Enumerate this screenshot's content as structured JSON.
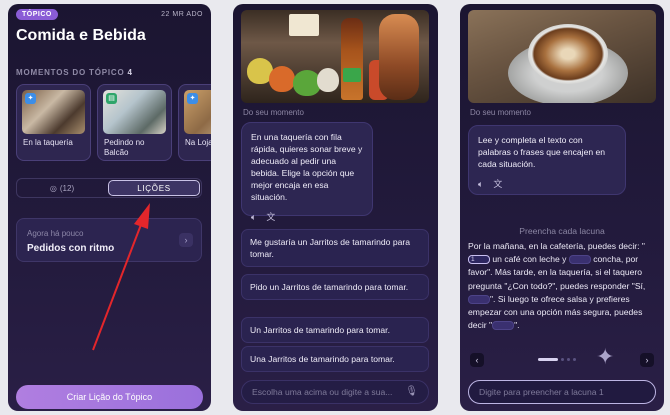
{
  "panel1": {
    "badge": "TÓPICO",
    "date": "22 MR ADO",
    "title": "Comida e Bebida",
    "moments_label": "MOMENTOS DO TÓPICO",
    "moments_count": "4",
    "moments": [
      {
        "label": "En la taquería"
      },
      {
        "label": "Pedindo no Balcão"
      },
      {
        "label": "Na Loja"
      }
    ],
    "tabs": {
      "first": "(12)",
      "second": "LIÇÕES"
    },
    "lesson": {
      "when": "Agora há pouco",
      "name": "Pedidos con ritmo"
    },
    "create_button": "Criar Lição do Tópico"
  },
  "panel2": {
    "from_moment": "Do seu momento",
    "prompt": "En una taquería con fila rápida, quieres sonar breve y adecuado al pedir una bebida. Elige la opción que mejor encaja en esa situación.",
    "options": [
      "Me gustaría un Jarritos de tamarindo para tomar.",
      "Pido un Jarritos de tamarindo para tomar.",
      "Un Jarritos de tamarindo para tomar.",
      "Una Jarritos de tamarindo para tomar."
    ],
    "input_placeholder": "Escolha uma acima ou digite a sua..."
  },
  "panel3": {
    "from_moment": "Do seu momento",
    "prompt": "Lee y completa el texto con palabras o frases que encajen en cada situación.",
    "hint": "Preencha cada lacuna",
    "cloze": {
      "p1": "Por la mañana, en la cafetería, puedes decir: \"",
      "blank1": "1",
      "p2": " un café con leche y ",
      "p3": " concha, por favor\". Más tarde, en la taquería, si el taquero pregunta \"¿Con todo?\", puedes responder \"Sí, ",
      "p4": "\". Si luego te ofrece salsa y prefieres empezar con una opción más segura, puedes decir \"",
      "p5": "\"."
    },
    "input_placeholder": "Digite para preencher a lacuna 1"
  },
  "colors": {
    "accent": "#8a5cd6",
    "arrow": "#e3262b",
    "panel_bg": "#1f1838"
  }
}
